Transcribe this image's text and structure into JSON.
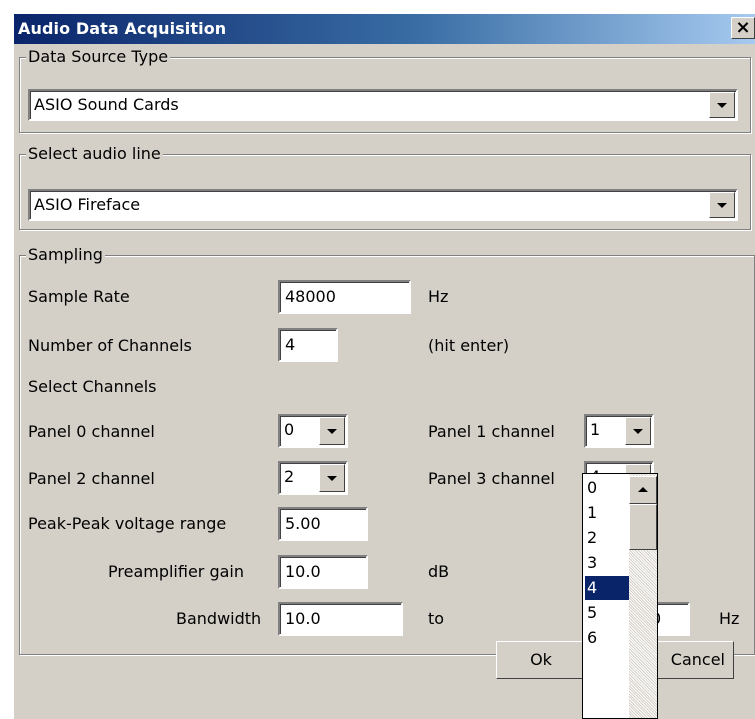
{
  "window": {
    "title": "Audio Data Acquisition",
    "close_glyph": "×"
  },
  "data_source": {
    "legend": "Data Source Type",
    "value": "ASIO Sound Cards"
  },
  "audio_line": {
    "legend": "Select audio line",
    "value": "ASIO Fireface"
  },
  "sampling": {
    "legend": "Sampling",
    "sample_rate_label": "Sample Rate",
    "sample_rate_value": "48000",
    "sample_rate_unit": "Hz",
    "num_channels_label": "Number of Channels",
    "num_channels_value": "4",
    "num_channels_hint": "(hit enter)",
    "select_channels_label": "Select Channels",
    "panel0_label": "Panel 0 channel",
    "panel0_value": "0",
    "panel1_label": "Panel 1 channel",
    "panel1_value": "1",
    "panel2_label": "Panel 2 channel",
    "panel2_value": "2",
    "panel3_label": "Panel 3 channel",
    "panel3_value": "4",
    "voltage_label": "Peak-Peak voltage range",
    "voltage_value": "5.00",
    "gain_label": "Preamplifier gain",
    "gain_value": "10.0",
    "gain_unit": "dB",
    "bandwidth_label": "Bandwidth",
    "bandwidth_low": "10.0",
    "bandwidth_to": "to",
    "bandwidth_high_partial": "0",
    "bandwidth_unit": "Hz"
  },
  "buttons": {
    "ok": "Ok",
    "cancel": "Cancel"
  },
  "channel_dropdown": {
    "options": [
      "0",
      "1",
      "2",
      "3",
      "4",
      "5",
      "6"
    ],
    "selected": "4"
  },
  "colors": {
    "title_start": "#0a246a",
    "title_end": "#a6caf0",
    "dialog_bg": "#d4d0c8",
    "selection": "#0a246a"
  }
}
